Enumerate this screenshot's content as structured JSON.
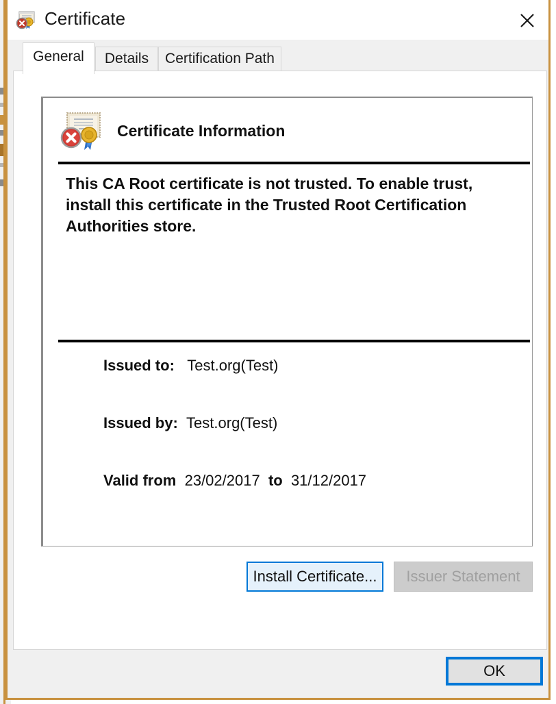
{
  "window": {
    "title": "Certificate",
    "title_icon": "certificate-untrusted-icon",
    "close_label": "✕",
    "border_color": "#c8913f"
  },
  "tabs": [
    {
      "label": "General",
      "active": true
    },
    {
      "label": "Details",
      "active": false
    },
    {
      "label": "Certification Path",
      "active": false
    }
  ],
  "general": {
    "icon": "certificate-untrusted-large-icon",
    "heading": "Certificate Information",
    "warning": "This CA Root certificate is not trusted. To enable trust, install this certificate in the Trusted Root Certification Authorities store.",
    "fields": {
      "issued_to_label": "Issued to:",
      "issued_to_value": "Test.org(Test)",
      "issued_by_label": "Issued by:",
      "issued_by_value": "Test.org(Test)",
      "valid_from_label": "Valid from",
      "valid_from_value": "23/02/2017",
      "valid_to_label": "to",
      "valid_to_value": "31/12/2017"
    },
    "buttons": {
      "install": "Install Certificate...",
      "issuer": "Issuer Statement"
    }
  },
  "footer": {
    "ok": "OK"
  },
  "colors": {
    "focus_blue": "#0078d7",
    "focus_fill": "#e5f1fb",
    "disabled_bg": "#cccccc",
    "disabled_text": "#a0a0a0"
  }
}
